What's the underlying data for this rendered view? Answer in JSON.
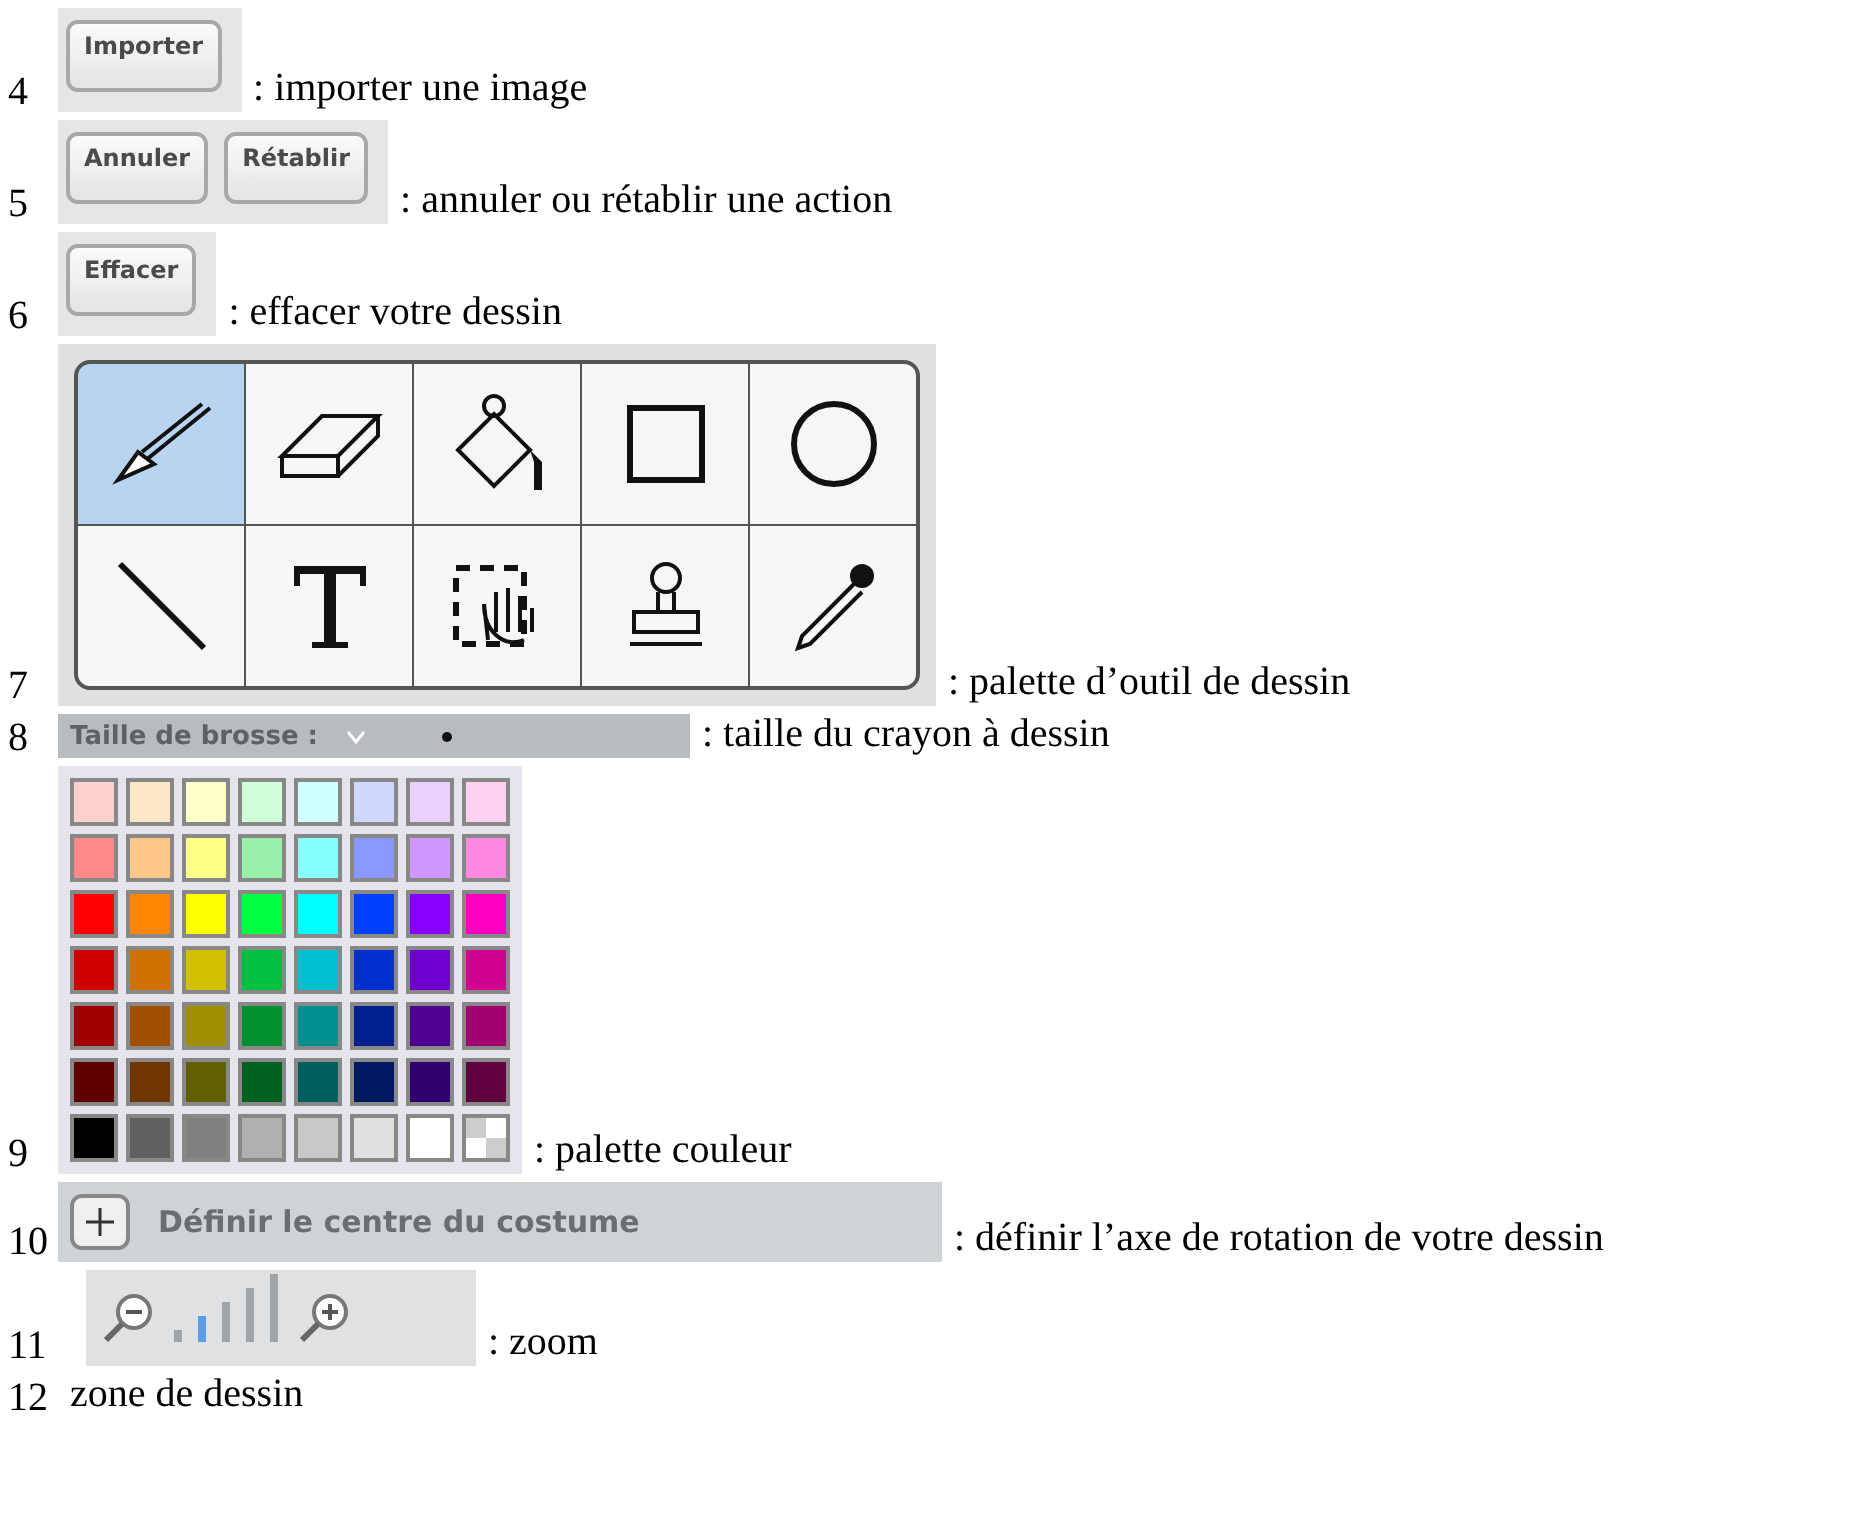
{
  "items": [
    {
      "number": "4",
      "kind": "buttons",
      "buttons": [
        "Importer"
      ],
      "caption": ": importer une image"
    },
    {
      "number": "5",
      "kind": "buttons",
      "buttons": [
        "Annuler",
        "Rétablir"
      ],
      "caption": ": annuler ou rétablir une action"
    },
    {
      "number": "6",
      "kind": "buttons",
      "buttons": [
        "Effacer"
      ],
      "caption": ": effacer votre dessin"
    },
    {
      "number": "7",
      "kind": "tools",
      "tools": [
        {
          "kind": "brush",
          "selected": true
        },
        {
          "kind": "eraser",
          "selected": false
        },
        {
          "kind": "fill",
          "selected": false
        },
        {
          "kind": "rectangle",
          "selected": false
        },
        {
          "kind": "ellipse",
          "selected": false
        },
        {
          "kind": "line",
          "selected": false
        },
        {
          "kind": "text",
          "selected": false
        },
        {
          "kind": "select",
          "selected": false
        },
        {
          "kind": "stamp",
          "selected": false
        },
        {
          "kind": "eyedropper",
          "selected": false
        }
      ],
      "caption": ": palette d’outil de dessin"
    },
    {
      "number": "8",
      "kind": "brush",
      "label": "Taille de brosse :",
      "caption": ": taille du crayon à dessin"
    },
    {
      "number": "9",
      "kind": "colors",
      "colors": [
        {
          "color": "#ffd0d0"
        },
        {
          "color": "#ffe8c8"
        },
        {
          "color": "#ffffc8"
        },
        {
          "color": "#d0ffd8"
        },
        {
          "color": "#d0ffff"
        },
        {
          "color": "#d0d8ff"
        },
        {
          "color": "#e8d0ff"
        },
        {
          "color": "#ffd0f0"
        },
        {
          "color": "#ff8888"
        },
        {
          "color": "#ffc888"
        },
        {
          "color": "#ffff88"
        },
        {
          "color": "#98f0a8"
        },
        {
          "color": "#88ffff"
        },
        {
          "color": "#8898ff"
        },
        {
          "color": "#d098ff"
        },
        {
          "color": "#ff88e0"
        },
        {
          "color": "#ff0000"
        },
        {
          "color": "#ff8800"
        },
        {
          "color": "#ffff00"
        },
        {
          "color": "#00ff40"
        },
        {
          "color": "#00ffff"
        },
        {
          "color": "#0040ff"
        },
        {
          "color": "#8800ff"
        },
        {
          "color": "#ff00c0"
        },
        {
          "color": "#d00000"
        },
        {
          "color": "#d07000"
        },
        {
          "color": "#d0c000"
        },
        {
          "color": "#00c040"
        },
        {
          "color": "#00c0d0"
        },
        {
          "color": "#0030d0"
        },
        {
          "color": "#7000d0"
        },
        {
          "color": "#d00090"
        },
        {
          "color": "#a00000"
        },
        {
          "color": "#a05000"
        },
        {
          "color": "#a09000"
        },
        {
          "color": "#009030"
        },
        {
          "color": "#009090"
        },
        {
          "color": "#002090"
        },
        {
          "color": "#500090"
        },
        {
          "color": "#a00070"
        },
        {
          "color": "#600000"
        },
        {
          "color": "#703800"
        },
        {
          "color": "#606000"
        },
        {
          "color": "#006020"
        },
        {
          "color": "#006060"
        },
        {
          "color": "#001860"
        },
        {
          "color": "#300070"
        },
        {
          "color": "#600040"
        },
        {
          "color": "#000000"
        },
        {
          "color": "#606060"
        },
        {
          "color": "#808080"
        },
        {
          "color": "#b0b0b0"
        },
        {
          "color": "#c8c8c8"
        },
        {
          "color": "#e0e0e0"
        },
        {
          "color": "#ffffff"
        },
        {
          "kind": "transparent"
        }
      ],
      "caption": ": palette couleur"
    },
    {
      "number": "10",
      "kind": "center",
      "label": "Définir le centre du costume",
      "caption": ": définir l’axe de rotation de votre dessin"
    },
    {
      "number": "11",
      "kind": "zoom",
      "steps": [
        {
          "selected": false
        },
        {
          "selected": true
        },
        {
          "selected": false
        },
        {
          "selected": false
        },
        {
          "selected": false
        }
      ],
      "caption": ": zoom"
    },
    {
      "number": "12",
      "kind": "plain",
      "caption": "zone de dessin"
    }
  ]
}
